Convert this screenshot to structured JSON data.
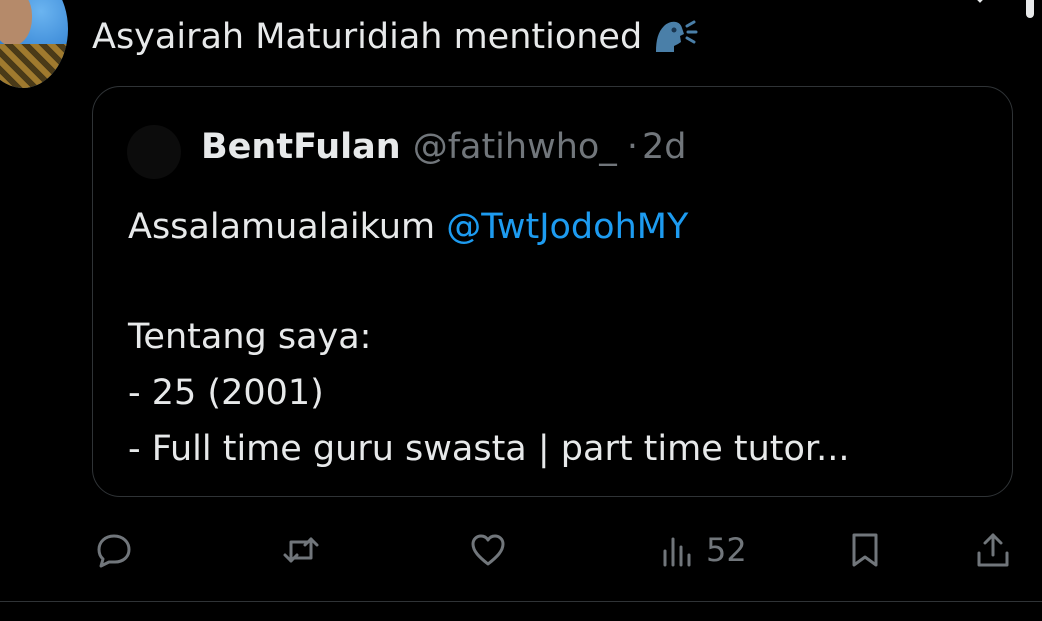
{
  "post": {
    "clipped_top_text": "",
    "social_context": "Asyairah Maturidiah mentioned",
    "emoji_icon": "speaking-head-icon"
  },
  "quote": {
    "author_name": "BentFulan",
    "author_handle": "@fatihwho_",
    "separator": "·",
    "time": "2d",
    "greeting": "Assalamualaikum",
    "mention": "@TwtJodohMY",
    "lines": [
      "Tentang saya:",
      "- 25 (2001)",
      "- Full time guru swasta | part time tutor..."
    ]
  },
  "actions": {
    "reply_icon": "reply-icon",
    "repost_icon": "repost-icon",
    "like_icon": "like-icon",
    "views_icon": "views-icon",
    "views_count": "52",
    "bookmark_icon": "bookmark-icon",
    "share_icon": "share-icon"
  },
  "colors": {
    "background": "#000000",
    "text": "#e7e9ea",
    "muted": "#71767b",
    "link": "#1d9bf0",
    "border": "#2f3336"
  }
}
